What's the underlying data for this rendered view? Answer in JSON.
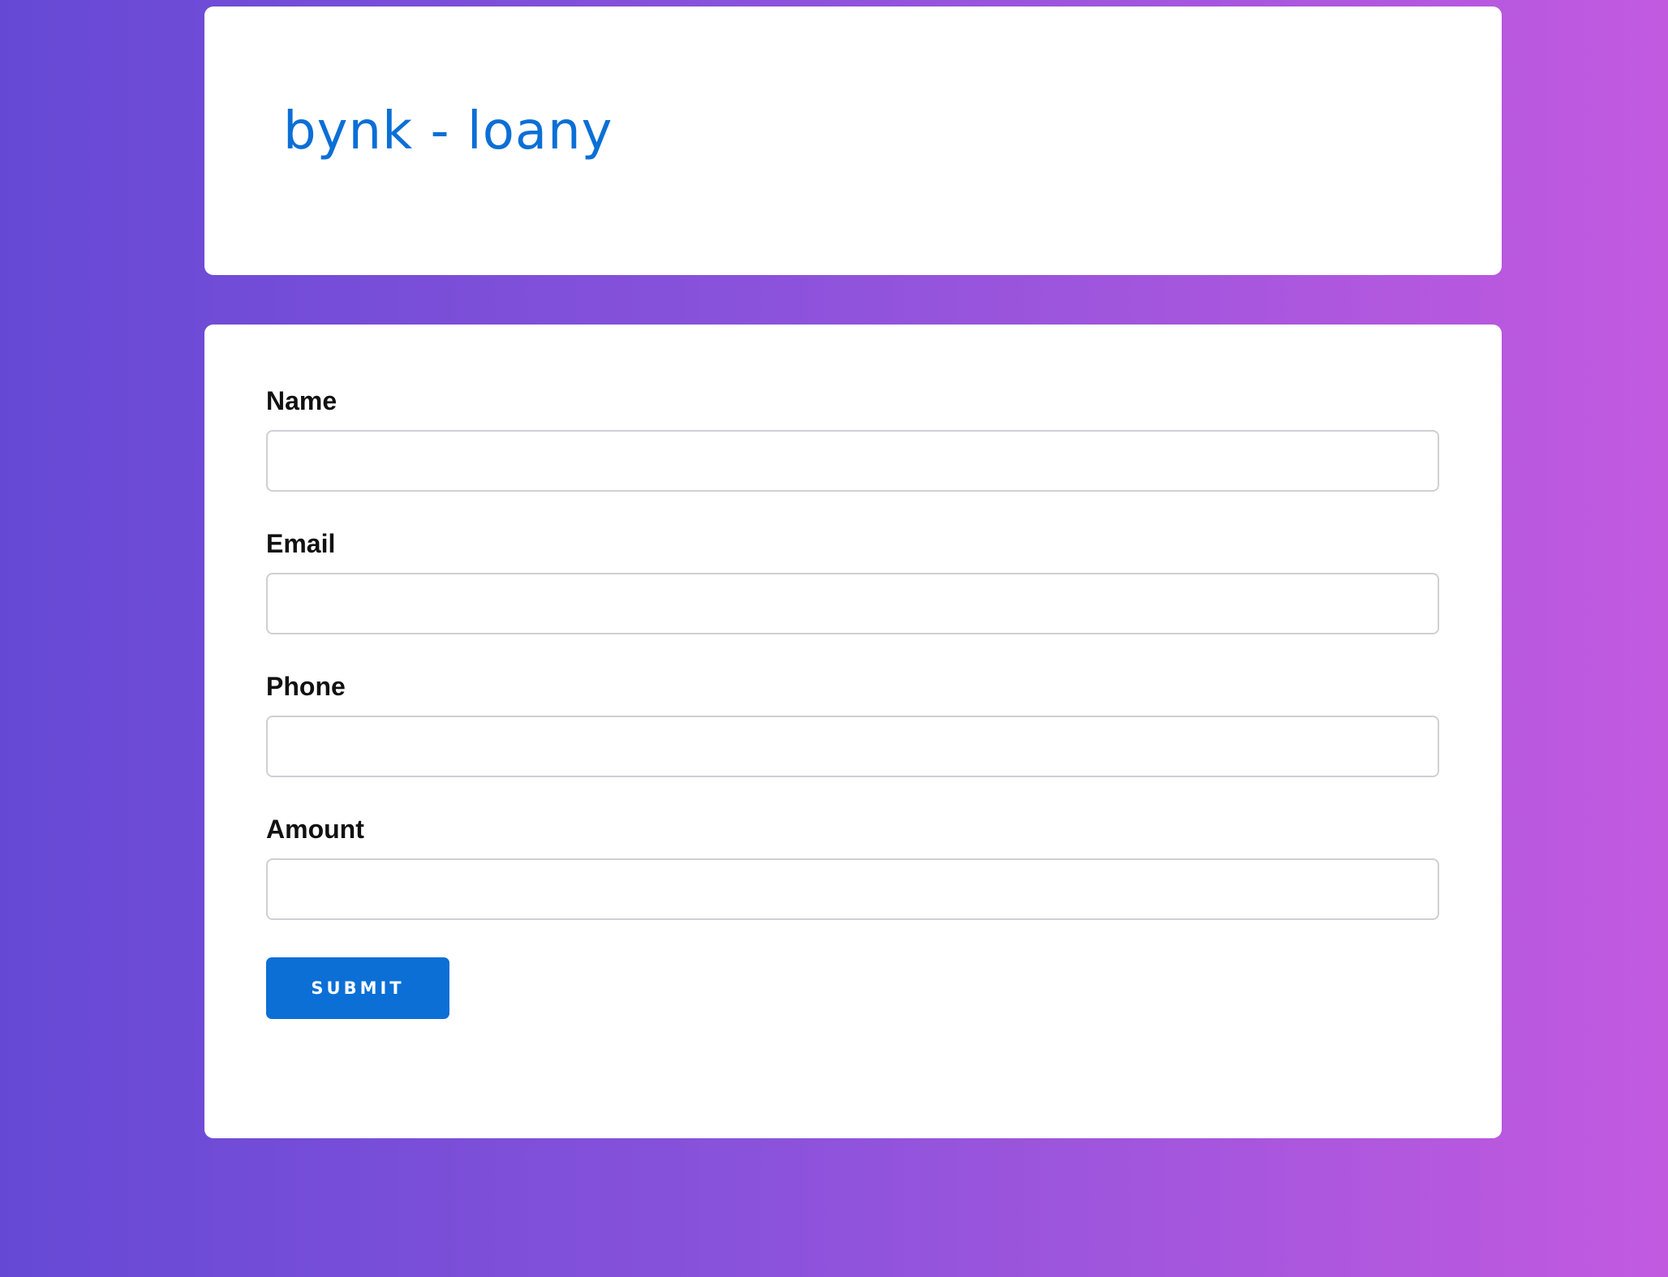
{
  "header": {
    "brand_title": "bynk - loany"
  },
  "form": {
    "fields": [
      {
        "label": "Name",
        "value": "",
        "placeholder": ""
      },
      {
        "label": "Email",
        "value": "",
        "placeholder": ""
      },
      {
        "label": "Phone",
        "value": "",
        "placeholder": ""
      },
      {
        "label": "Amount",
        "value": "",
        "placeholder": ""
      }
    ],
    "submit_label": "SUBMIT"
  },
  "colors": {
    "accent": "#0b6fd6",
    "background_gradient_start": "#6549d5",
    "background_gradient_end": "#c25ae0",
    "card_background": "#ffffff",
    "label_text": "#111111",
    "input_border": "#cfcfd4"
  }
}
